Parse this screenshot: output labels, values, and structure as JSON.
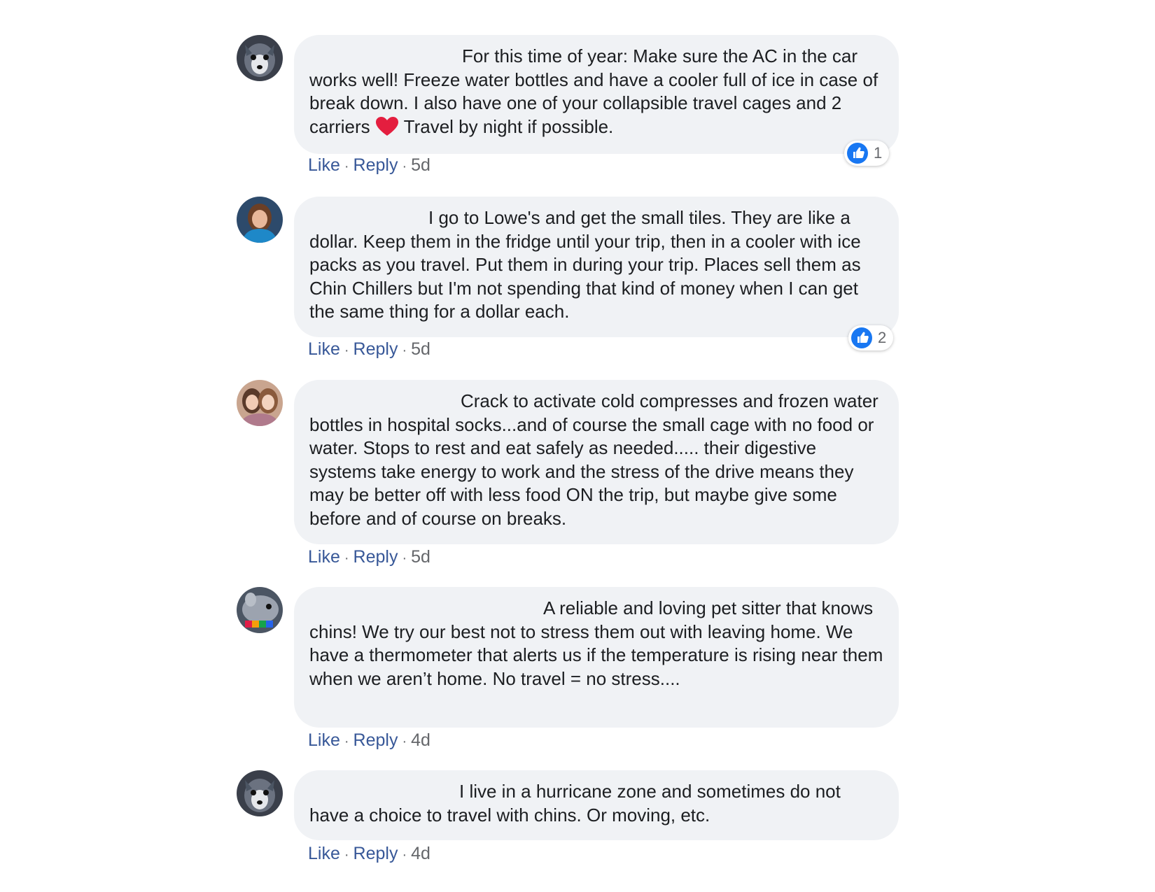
{
  "comments": [
    {
      "text_before": "For this time of year: Make sure the AC in the car works well! Freeze water bottles and have a cooler full of ice in case of break down. I also have one of your collapsible travel cages and 2 carriers ",
      "emoji": "heart-emoji",
      "text_after": " Travel by night if possible.",
      "actions": {
        "like": "Like",
        "reply": "Reply",
        "sep": "·",
        "time": "5d"
      },
      "reaction_count": "1",
      "avatar_icon": "avatar-husky-icon"
    },
    {
      "text": "I go to Lowe's and get the small tiles. They are like a dollar. Keep them in the fridge until your trip, then in a cooler with ice packs as you travel. Put them in during your trip. Places sell them as Chin Chillers but I'm not spending that kind of money when I can get the same thing for a dollar each.",
      "actions": {
        "like": "Like",
        "reply": "Reply",
        "sep": "·",
        "time": "5d"
      },
      "reaction_count": "2",
      "avatar_icon": "avatar-woman-icon"
    },
    {
      "text": "Crack to activate cold compresses and frozen water bottles in hospital socks...and of course the small cage with no food or water. Stops to rest and eat safely as needed..... their digestive systems take energy to work and the stress of the drive means they may be better off with less food ON the trip, but maybe give some before and of course on breaks.",
      "actions": {
        "like": "Like",
        "reply": "Reply",
        "sep": "·",
        "time": "5d"
      },
      "avatar_icon": "avatar-two-people-icon"
    },
    {
      "text": "A reliable and loving pet sitter that knows chins! We try our best not to stress them out with leaving home. We have a thermometer that alerts us if the temperature is rising near them when we aren’t home. No travel = no stress....",
      "actions": {
        "like": "Like",
        "reply": "Reply",
        "sep": "·",
        "time": "4d"
      },
      "avatar_icon": "avatar-chinchilla-icon"
    },
    {
      "text": "I live in a hurricane zone and sometimes do not have a choice to travel with chins. Or moving, etc.",
      "actions": {
        "like": "Like",
        "reply": "Reply",
        "sep": "·",
        "time": "4d"
      },
      "avatar_icon": "avatar-husky-icon"
    }
  ],
  "colors": {
    "bubble_bg": "#f0f2f5",
    "link": "#385898",
    "meta": "#65676b",
    "like_blue": "#1877f2",
    "heart_red": "#e41e3f"
  }
}
